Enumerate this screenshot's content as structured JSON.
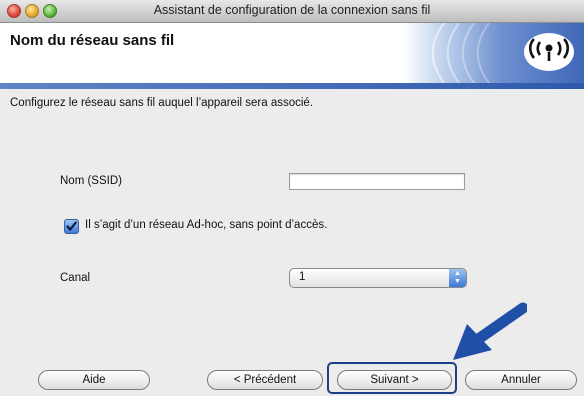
{
  "window": {
    "title": "Assistant de configuration de la connexion sans fil"
  },
  "header": {
    "title": "Nom du réseau sans fil",
    "logo_icon": "wifi-icon"
  },
  "body": {
    "instruction": "Configurez le réseau sans fil auquel l’appareil sera associé.",
    "ssid_label": "Nom (SSID)",
    "ssid_value": "",
    "adhoc_checked": true,
    "adhoc_label": "Il s’agit d’un réseau Ad-hoc, sans point d’accès.",
    "channel_label": "Canal",
    "channel_value": "1"
  },
  "buttons": {
    "help": "Aide",
    "previous": "< Précédent",
    "next": "Suivant >",
    "cancel": "Annuler"
  },
  "colors": {
    "accent": "#2f59ad",
    "arrow": "#1f4fa6"
  }
}
